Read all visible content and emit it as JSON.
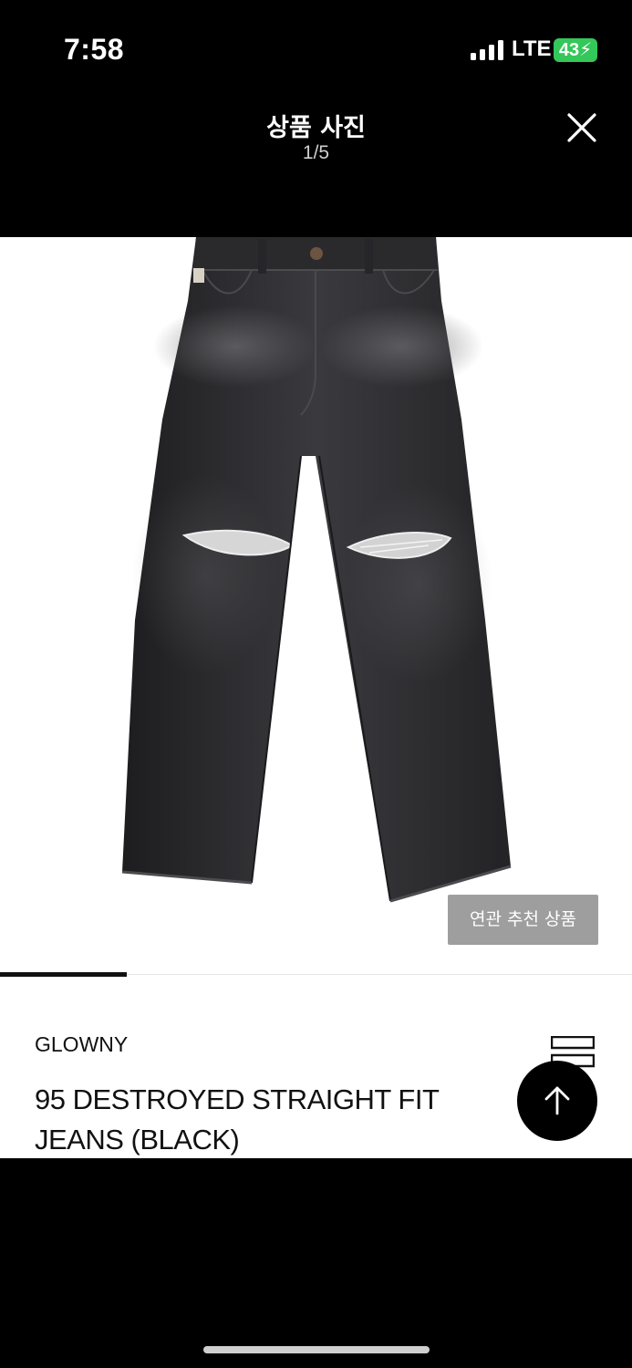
{
  "status_bar": {
    "time": "7:58",
    "network": "LTE",
    "battery": "43"
  },
  "header": {
    "title": "상품 사진",
    "counter": "1/5"
  },
  "gallery": {
    "current_index": 1,
    "total": 5,
    "recommend_label": "연관 추천 상품"
  },
  "product": {
    "brand": "GLOWNY",
    "name": "95 DESTROYED STRAIGHT FIT JEANS (BLACK)"
  },
  "icons": {
    "close": "close-icon",
    "compare": "compare-icon",
    "scroll_top": "arrow-up-icon",
    "signal": "signal-icon",
    "battery": "battery-icon"
  },
  "colors": {
    "battery": "#34c759",
    "recommend_button": "#9e9e9e",
    "denim": "#2b2b2e"
  }
}
